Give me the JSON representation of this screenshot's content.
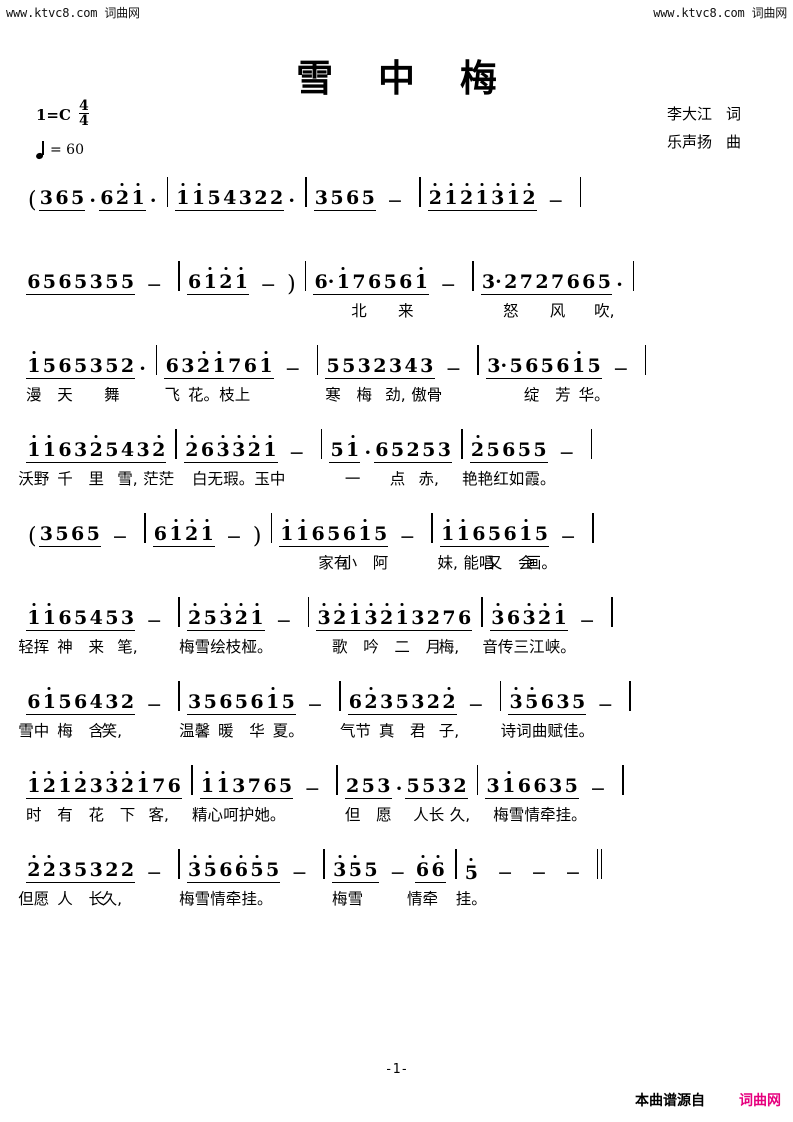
{
  "watermark": {
    "left": "www.ktvc8.com 词曲网",
    "right": "www.ktvc8.com 词曲网"
  },
  "title": "雪 中 梅",
  "meta": {
    "key_label": "1=C",
    "meter_num": "4",
    "meter_den": "4",
    "tempo_value": "= 60",
    "lyricist": "李大江",
    "lyricist_role": "词",
    "composer": "乐声扬",
    "composer_role": "曲"
  },
  "footer": {
    "page_number": "-1-",
    "credit_text": "本曲谱源自",
    "brand": "词曲网",
    "brand_color": "#e6007e"
  },
  "score": {
    "lines": [
      {
        "id": "line-1",
        "notes_text": "( 3 6 5 ·  6 2̇ 1̇ ·  | 1̇ 1̇ 5 4 3 2 2 ·  | 3 5  6 5  −  | 2̇ 1̇ 2̇ 1̇ 3̇ 1̇ 2̇  −  |",
        "lyrics": []
      },
      {
        "id": "line-2",
        "notes_text": "6 5 6 5 3 5 5  −  | 6 1̇  2̇ 1̇  −  ) | 6· 1̇ 7 6 5 6 1̇  −  | 3· 2 7 2 7 6 6 5 ·  |",
        "lyrics": [
          "北",
          "来",
          "怒",
          "风",
          "吹,"
        ]
      },
      {
        "id": "line-3",
        "notes_text": "1̇  5 6 5 3 5 2 ·  | 6 3 2̇ 1̇ 7 6 1̇  −  | 5 5 3 2 3 4 3  −  | 3· 5 6 5 6 1̇ 5  −  |",
        "lyrics": [
          "漫",
          "天",
          "舞",
          "飞",
          "花。",
          "枝上",
          "寒",
          "梅",
          "劲,",
          "傲骨",
          "绽",
          "芳",
          "华。"
        ]
      },
      {
        "id": "line-4",
        "notes_text": "1̇ 1̇ 6 3  2̇ 5 4 3 2̇  | 2̇ 6  3̇ 3̇ 2̇ 1̇  −  | 5 1̇ ·  6 5 2 5 3  | 2̇ 5  6 5 5  −  |",
        "lyrics": [
          "沃野",
          "千",
          "里",
          "雪,",
          "茫茫",
          "白无",
          "瑕。",
          "玉中",
          "一",
          "点",
          "赤,",
          "艳艳",
          "红如",
          "霞。"
        ]
      },
      {
        "id": "line-5",
        "notes_text": "( 3 5  6 5  −  | 6 1̇  2̇ 1̇  −  ) | 1̇ 1̇ 6 5 6 1̇ 5  −  | 1̇ 1̇ 6 5 6 1̇ 5  −  |",
        "lyrics": [
          "家有",
          "小",
          "阿",
          "妹,",
          "能唱",
          "又",
          "会",
          "画。"
        ]
      },
      {
        "id": "line-6",
        "notes_text": "1̇ 1̇ 6 5 4 5 3  −  | 2̇ 5  3̇ 2̇ 1̇  −  | 3̇ 2̇ 1̇ 3̇ 2̇  1̇ 3 2 7 6  | 3̇ 6  3̇ 2̇ 1̇  −  |",
        "lyrics": [
          "轻挥",
          "神",
          "来",
          "笔,",
          "梅雪",
          "绘枝",
          "桠。",
          "歌",
          "吟",
          "二",
          "月",
          "梅,",
          "音传",
          "三江",
          "峡。"
        ]
      },
      {
        "id": "line-7",
        "notes_text": "6 1̇  5 6 4 3 2  −  | 3 5  6 5 6 1̇ 5  −  | 6 2̇  3 5 3 2 2̇  −  | 3̇ 5̇  6 3 5  −  |",
        "lyrics": [
          "雪中",
          "梅",
          "含",
          "笑,",
          "温馨",
          "暖",
          "华",
          "夏。",
          "气节",
          "真",
          "君",
          "子,",
          "诗词",
          "曲赋",
          "佳。"
        ]
      },
      {
        "id": "line-8",
        "notes_text": "1̇ 2̇ 1̇ 2̇ 3  3̇ 2̇ 1̇ 7 6  | 1̇ 1̇ 3 7 6 5  −  | 2 5 3 ·  5 5 3 2  | 3 1̇  6 6 3 5  −  |",
        "lyrics": [
          "时",
          "有",
          "花",
          "下",
          "客,",
          "精心",
          "呵护",
          "她。",
          "但",
          "愿",
          "人长",
          "久,",
          "梅雪",
          "情牵",
          "挂。"
        ]
      },
      {
        "id": "line-9",
        "notes_text": "2̇ 2̇  3 5 3 2  2  −  | 3̇ 5̇  6 6̇ 5̇ 5  −  | 3̇ 5̇ 5  −  6̇ 6̇ | 5̇  −  −  −  ‖",
        "lyrics": [
          "但愿",
          "人",
          "长",
          "久,",
          "梅雪",
          "情牵",
          "挂。",
          "梅",
          "雪",
          "情牵",
          "挂。"
        ]
      }
    ],
    "glyphs": {
      "open_paren": "(",
      "close_paren": ")",
      "dash": "−",
      "aug_dot": "·",
      "barline": "|",
      "final_barline": "‖"
    }
  }
}
